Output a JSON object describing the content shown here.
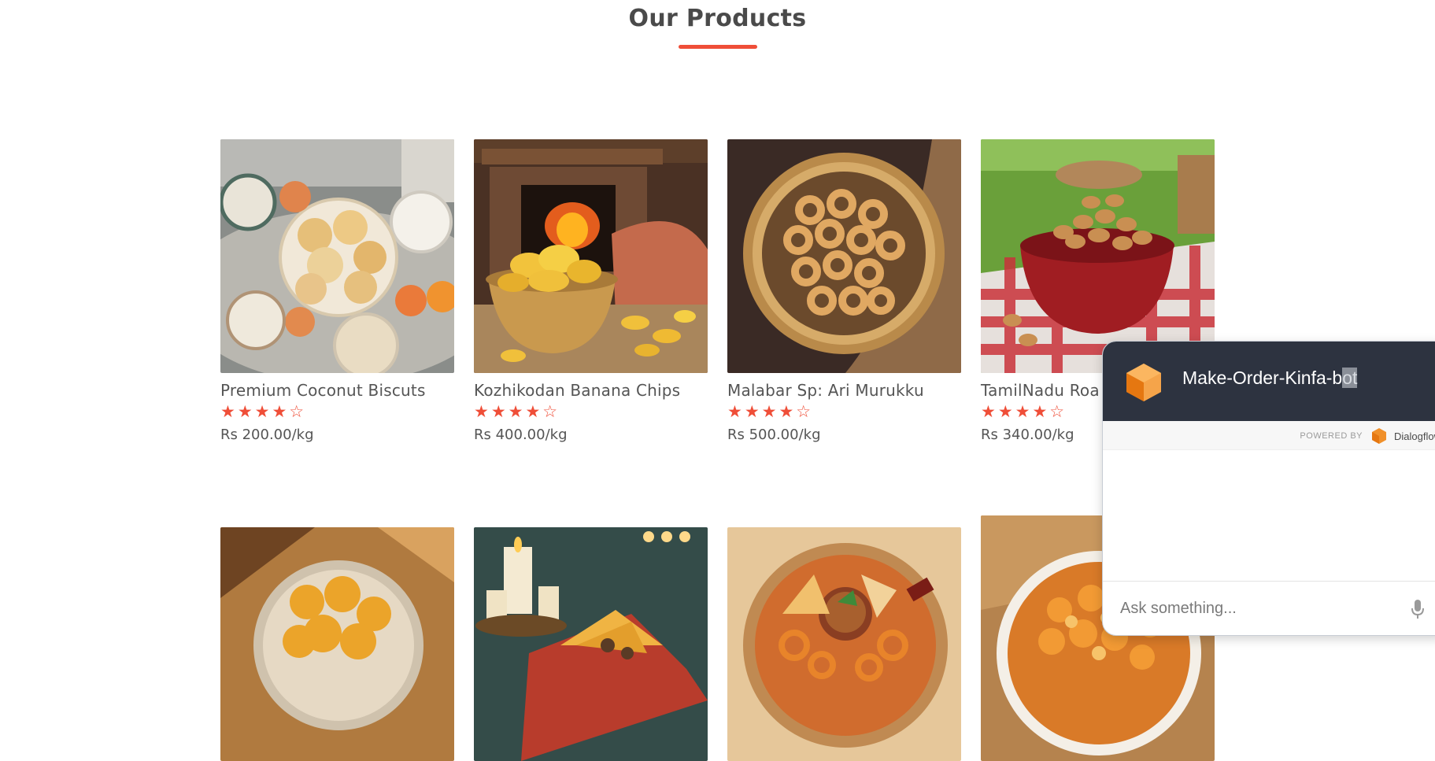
{
  "section": {
    "title": "Our Products"
  },
  "products": [
    {
      "name": "Premium Coconut Biscuts",
      "rating": 4,
      "rating_max": 5,
      "stars": "★★★★☆",
      "price": "Rs 200.00/kg"
    },
    {
      "name": "Kozhikodan Banana Chips",
      "rating": 4,
      "rating_max": 5,
      "stars": "★★★★☆",
      "price": "Rs 400.00/kg"
    },
    {
      "name": "Malabar Sp: Ari Murukku",
      "rating": 4,
      "rating_max": 5,
      "stars": "★★★★☆",
      "price": "Rs 500.00/kg"
    },
    {
      "name": "TamilNadu Roa",
      "rating": 4,
      "rating_max": 5,
      "stars": "★★★★☆",
      "price": "Rs 340.00/kg"
    }
  ],
  "accent_color": "#ef4e38",
  "chat": {
    "title_main": "Make-Order-Kinfa-b",
    "title_selected": "ot",
    "powered_by": "POWERED BY",
    "provider": "Dialogflow",
    "input_placeholder": "Ask something...",
    "header_color": "#2d3340",
    "icons": [
      "cube-logo-icon",
      "dialogflow-logo-icon",
      "microphone-icon"
    ]
  }
}
